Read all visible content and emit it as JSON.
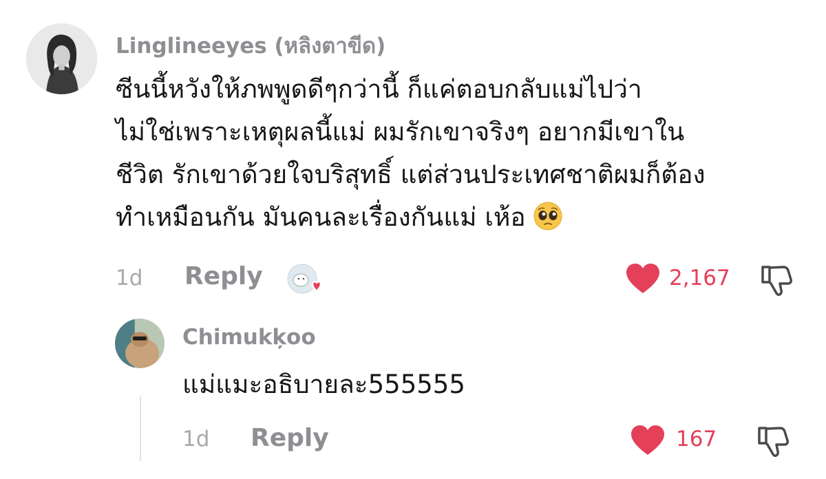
{
  "comment": {
    "username": "Linglineeyes (หลิงตาขีด)",
    "text_lines": [
      "ซีนนี้หวังให้ภพพูดดีๆกว่านี้ ก็แค่ตอบกลับแม่ไปว่า",
      "ไม่ใช่เพราะเหตุผลนี้แม่ ผมรักเขาจริงๆ อยากมีเขาใน",
      "ชีวิต รักเขาด้วยใจบริสุทธิ์ แต่ส่วนประเทศชาติผมก็ต้อง",
      "ทำเหมือนกัน มันคนละเรื่องกันแม่ เห้อ"
    ],
    "emoji": "pleading-face-emoji",
    "time": "1d",
    "reply_label": "Reply",
    "like_count": "2,167",
    "liked": true,
    "creator_liked": true
  },
  "reply": {
    "username": "Chimukķoo",
    "text": "แม่แมะอธิบายละ555555",
    "time": "1d",
    "reply_label": "Reply",
    "like_count": "167",
    "liked": true
  },
  "colors": {
    "like_red": "#e4405a",
    "username_gray": "#8e8e93",
    "meta_gray": "#a8a8ad",
    "text": "#161616"
  },
  "icons": {
    "like": "heart-icon",
    "dislike": "thumbs-down-icon",
    "creator_liked": "creator-liked-badge-icon"
  }
}
